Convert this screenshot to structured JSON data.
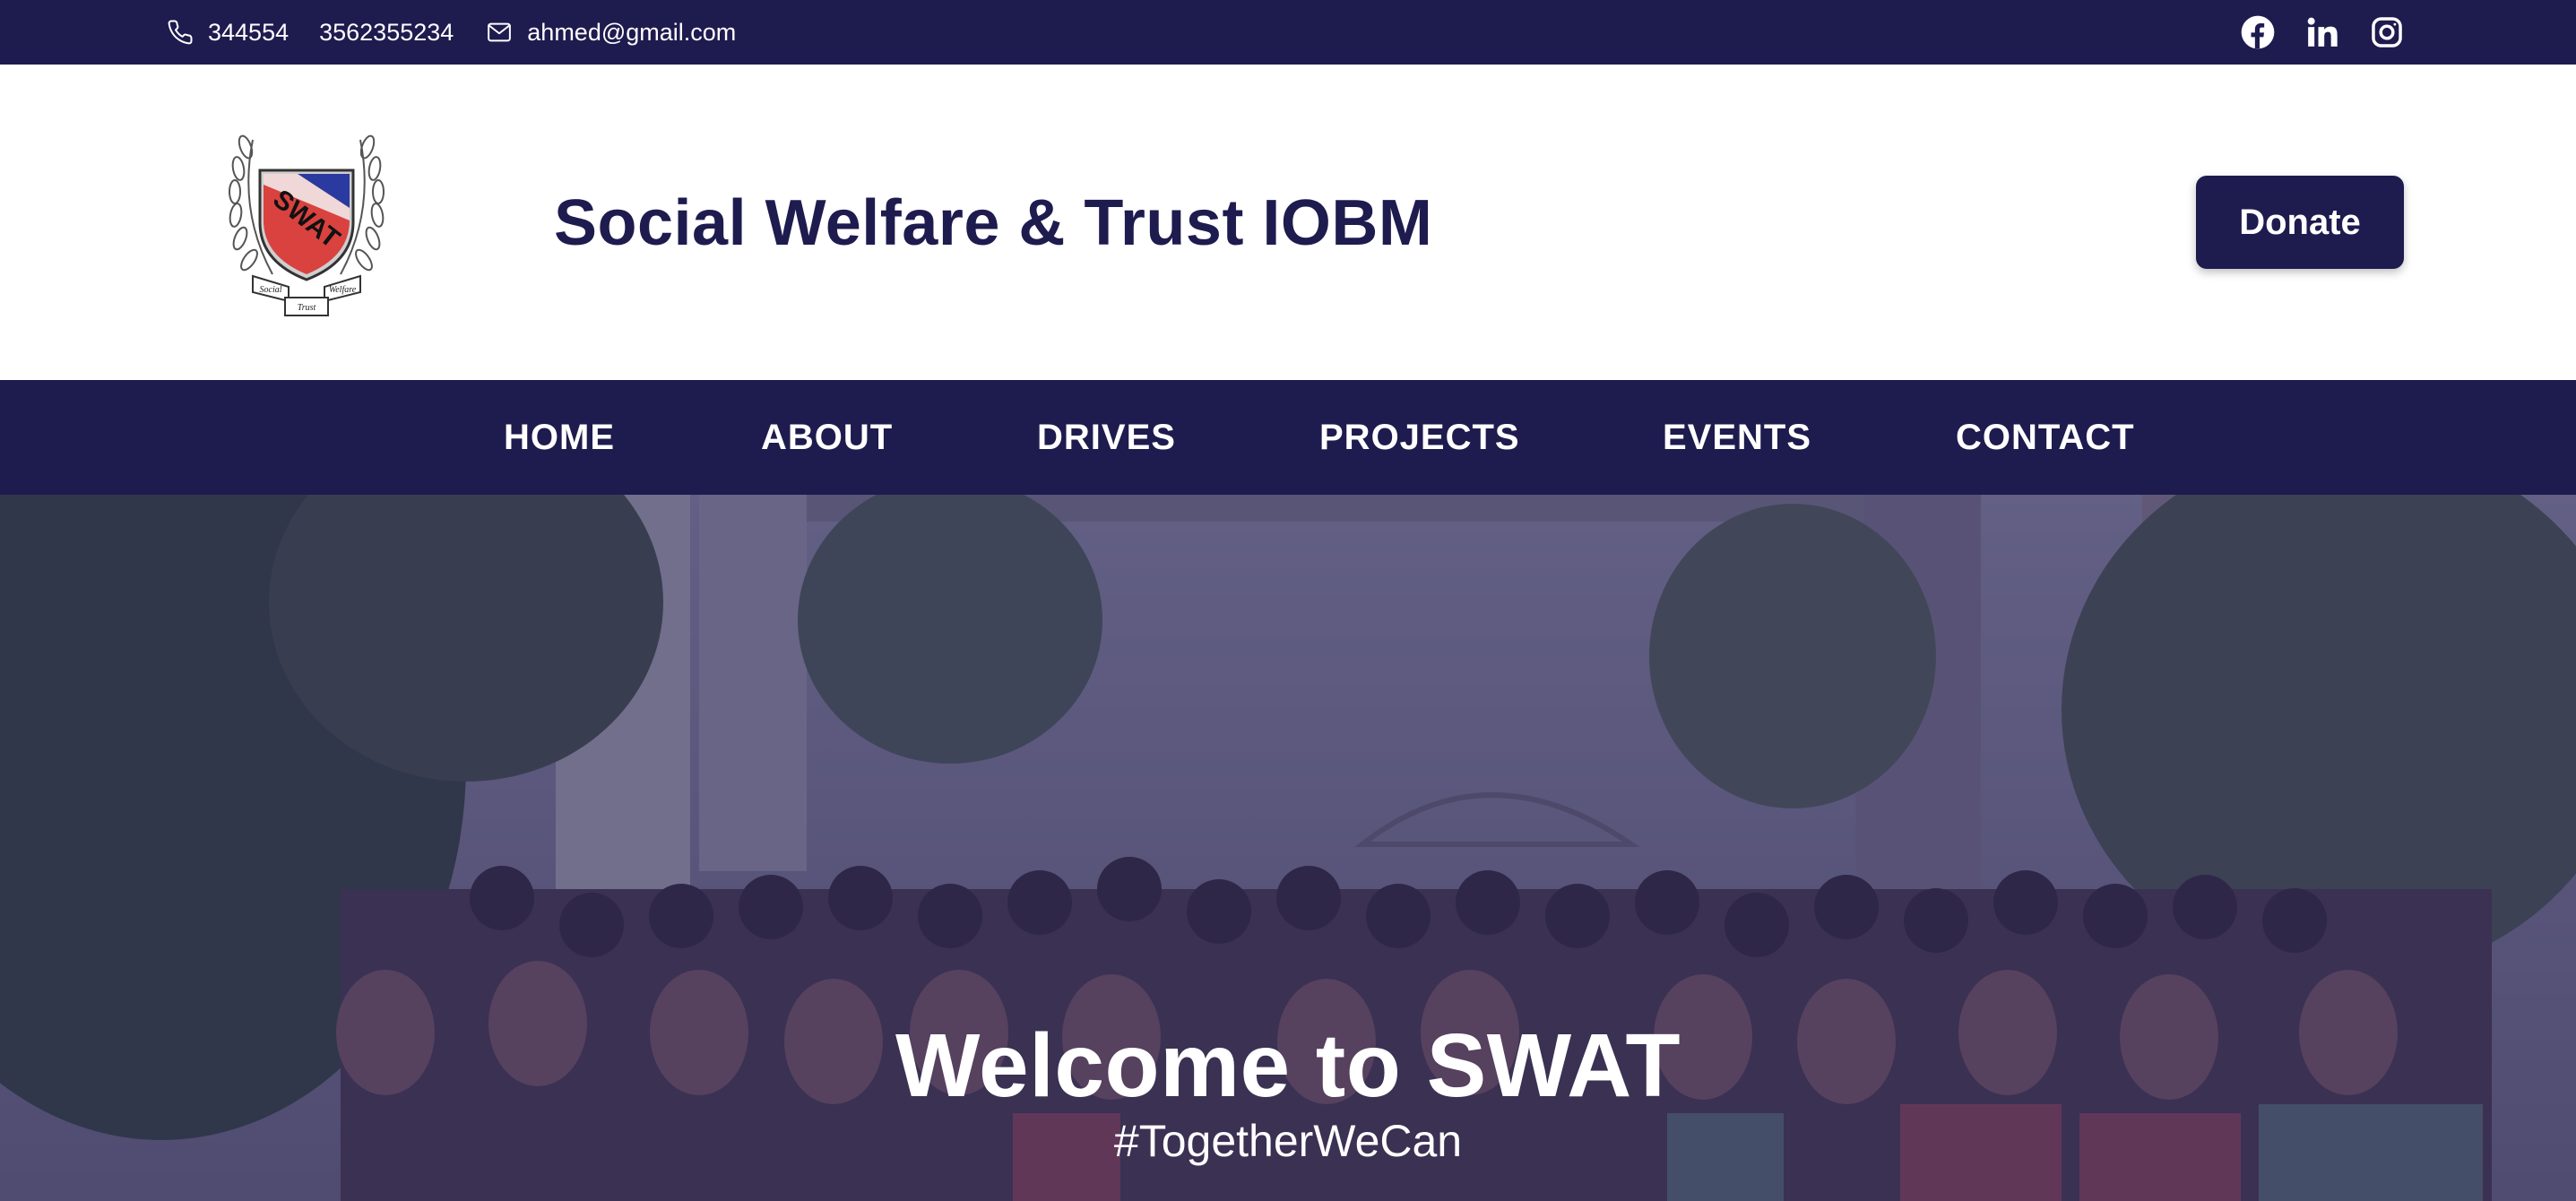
{
  "topbar": {
    "phone_1": "344554",
    "phone_2": "3562355234",
    "email": "ahmed@gmail.com",
    "social_icons": [
      "facebook-icon",
      "linkedin-icon",
      "instagram-icon"
    ]
  },
  "header": {
    "logo_text": "SWAT",
    "logo_ribbon": [
      "Social",
      "Welfare",
      "Trust"
    ],
    "title": "Social Welfare & Trust IOBM",
    "donate_label": "Donate"
  },
  "nav": {
    "items": [
      {
        "label": "HOME"
      },
      {
        "label": "ABOUT"
      },
      {
        "label": "DRIVES"
      },
      {
        "label": "PROJECTS"
      },
      {
        "label": "EVENTS"
      },
      {
        "label": "CONTACT"
      }
    ]
  },
  "hero": {
    "title": "Welcome to SWAT",
    "subtitle": "#TogetherWeCan"
  },
  "colors": {
    "brand_navy": "#1e1b4f",
    "white": "#ffffff",
    "shield_red": "#d9423f",
    "shield_blue": "#2a3aa0"
  }
}
